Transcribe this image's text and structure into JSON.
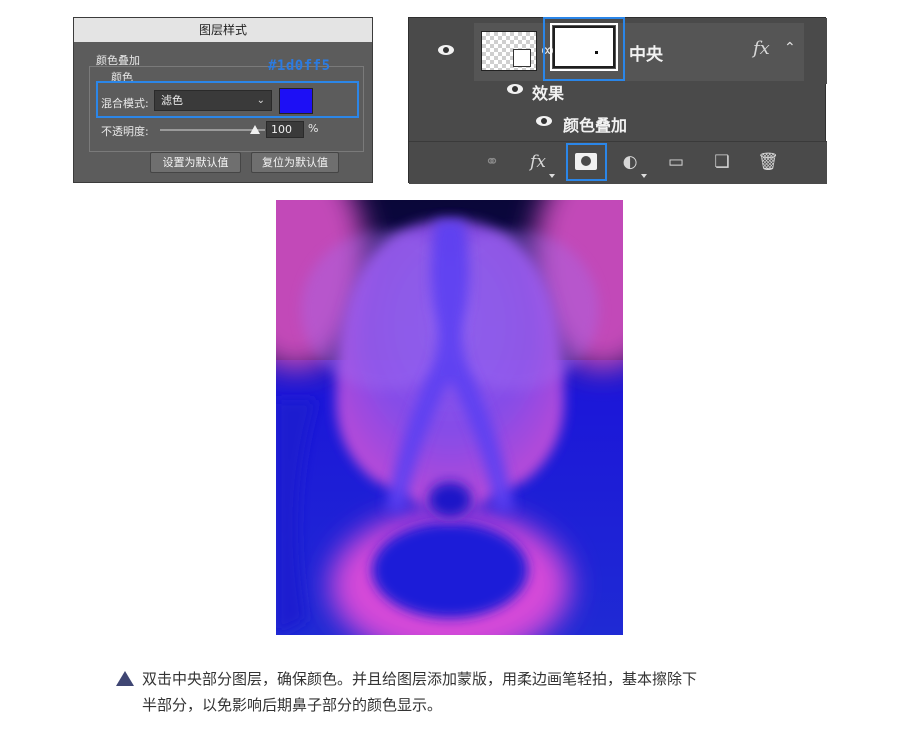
{
  "layer_style_dialog": {
    "title": "图层样式",
    "section_title": "颜色叠加",
    "group_title": "颜色",
    "annotation_hex": "#1d0ff5",
    "blend_mode_label": "混合模式:",
    "blend_mode_value": "滤色",
    "overlay_color": "#1d0ff5",
    "opacity_label": "不透明度:",
    "opacity_value": "100",
    "opacity_unit": "%",
    "opacity_fraction": 1.0,
    "make_default_label": "设置为默认值",
    "reset_default_label": "复位为默认值"
  },
  "layers_panel": {
    "layer_name": "中央",
    "fx_mark": "fx",
    "effects_label": "效果",
    "color_overlay_label": "颜色叠加",
    "toolbar_icons": [
      "link-icon",
      "fx-icon",
      "add-mask-icon",
      "adjustment-icon",
      "folder-icon",
      "new-layer-icon",
      "trash-icon"
    ],
    "highlight_color": "#2b86e8"
  },
  "caption": {
    "line1": "双击中央部分图层，确保颜色。并且给图层添加蒙版，用柔边画笔轻拍，基本擦除下",
    "line2": "半部分，以免影响后期鼻子部分的颜色显示。"
  }
}
